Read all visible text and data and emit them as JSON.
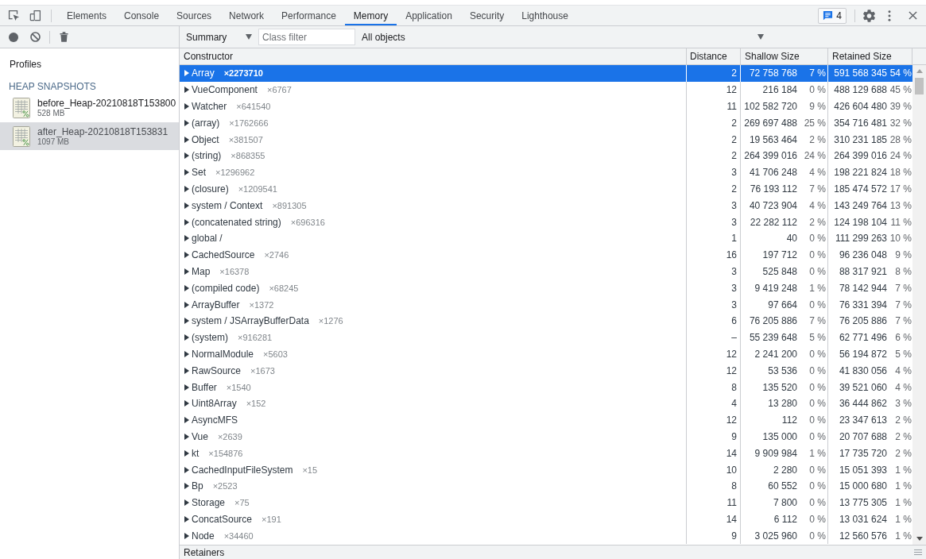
{
  "toolbar": {
    "tabs": [
      {
        "label": "Elements",
        "selected": false
      },
      {
        "label": "Console",
        "selected": false
      },
      {
        "label": "Sources",
        "selected": false
      },
      {
        "label": "Network",
        "selected": false
      },
      {
        "label": "Performance",
        "selected": false
      },
      {
        "label": "Memory",
        "selected": true
      },
      {
        "label": "Application",
        "selected": false
      },
      {
        "label": "Security",
        "selected": false
      },
      {
        "label": "Lighthouse",
        "selected": false
      }
    ],
    "issues_count": "4"
  },
  "memory_toolbar": {
    "view_select": "Summary",
    "class_filter": {
      "placeholder": "Class filter"
    },
    "object_select": "All objects"
  },
  "sidebar": {
    "title": "Profiles",
    "section": "HEAP SNAPSHOTS",
    "snapshots": [
      {
        "name": "before_Heap-20210818T153800",
        "size": "528 MB",
        "selected": false
      },
      {
        "name": "after_Heap-20210818T153831",
        "size": "1097 MB",
        "selected": true
      }
    ]
  },
  "table": {
    "columns": [
      "Constructor",
      "Distance",
      "Shallow Size",
      "Retained Size"
    ],
    "rows": [
      {
        "name": "Array",
        "count": "×2273710",
        "distance": "2",
        "shallow_size": "72 758 768",
        "shallow_percent": "7 %",
        "retained_size": "591 568 345",
        "retained_percent": "54 %",
        "selected": true,
        "expanded": false
      },
      {
        "name": "VueComponent",
        "count": "×6767",
        "distance": "12",
        "shallow_size": "216 184",
        "shallow_percent": "0 %",
        "retained_size": "488 129 688",
        "retained_percent": "45 %",
        "selected": false,
        "expanded": false
      },
      {
        "name": "Watcher",
        "count": "×641540",
        "distance": "11",
        "shallow_size": "102 582 720",
        "shallow_percent": "9 %",
        "retained_size": "426 604 480",
        "retained_percent": "39 %",
        "selected": false,
        "expanded": false
      },
      {
        "name": "(array)",
        "count": "×1762666",
        "distance": "2",
        "shallow_size": "269 697 488",
        "shallow_percent": "25 %",
        "retained_size": "354 716 481",
        "retained_percent": "32 %",
        "selected": false,
        "expanded": false
      },
      {
        "name": "Object",
        "count": "×381507",
        "distance": "2",
        "shallow_size": "19 563 464",
        "shallow_percent": "2 %",
        "retained_size": "310 231 185",
        "retained_percent": "28 %",
        "selected": false,
        "expanded": false
      },
      {
        "name": "(string)",
        "count": "×868355",
        "distance": "2",
        "shallow_size": "264 399 016",
        "shallow_percent": "24 %",
        "retained_size": "264 399 016",
        "retained_percent": "24 %",
        "selected": false,
        "expanded": false
      },
      {
        "name": "Set",
        "count": "×1296962",
        "distance": "3",
        "shallow_size": "41 706 248",
        "shallow_percent": "4 %",
        "retained_size": "198 221 824",
        "retained_percent": "18 %",
        "selected": false,
        "expanded": false
      },
      {
        "name": "(closure)",
        "count": "×1209541",
        "distance": "2",
        "shallow_size": "76 193 112",
        "shallow_percent": "7 %",
        "retained_size": "185 474 572",
        "retained_percent": "17 %",
        "selected": false,
        "expanded": false
      },
      {
        "name": "system / Context",
        "count": "×891305",
        "distance": "3",
        "shallow_size": "40 723 904",
        "shallow_percent": "4 %",
        "retained_size": "143 249 764",
        "retained_percent": "13 %",
        "selected": false,
        "expanded": false
      },
      {
        "name": "(concatenated string)",
        "count": "×696316",
        "distance": "3",
        "shallow_size": "22 282 112",
        "shallow_percent": "2 %",
        "retained_size": "124 198 104",
        "retained_percent": "11 %",
        "selected": false,
        "expanded": false
      },
      {
        "name": "global /",
        "distance": "1",
        "shallow_size": "40",
        "shallow_percent": "0 %",
        "retained_size": "111 299 263",
        "retained_percent": "10 %",
        "selected": false,
        "expanded": false
      },
      {
        "name": "CachedSource",
        "count": "×2746",
        "distance": "16",
        "shallow_size": "197 712",
        "shallow_percent": "0 %",
        "retained_size": "96 236 048",
        "retained_percent": "9 %",
        "selected": false,
        "expanded": false
      },
      {
        "name": "Map",
        "count": "×16378",
        "distance": "3",
        "shallow_size": "525 848",
        "shallow_percent": "0 %",
        "retained_size": "88 317 921",
        "retained_percent": "8 %",
        "selected": false,
        "expanded": false
      },
      {
        "name": "(compiled code)",
        "count": "×68245",
        "distance": "3",
        "shallow_size": "9 419 248",
        "shallow_percent": "1 %",
        "retained_size": "78 142 944",
        "retained_percent": "7 %",
        "selected": false,
        "expanded": false
      },
      {
        "name": "ArrayBuffer",
        "count": "×1372",
        "distance": "3",
        "shallow_size": "97 664",
        "shallow_percent": "0 %",
        "retained_size": "76 331 394",
        "retained_percent": "7 %",
        "selected": false,
        "expanded": false
      },
      {
        "name": "system / JSArrayBufferData",
        "count": "×1276",
        "distance": "6",
        "shallow_size": "76 205 886",
        "shallow_percent": "7 %",
        "retained_size": "76 205 886",
        "retained_percent": "7 %",
        "selected": false,
        "expanded": false
      },
      {
        "name": "(system)",
        "count": "×916281",
        "distance": "–",
        "shallow_size": "55 239 648",
        "shallow_percent": "5 %",
        "retained_size": "62 771 496",
        "retained_percent": "6 %",
        "selected": false,
        "expanded": false
      },
      {
        "name": "NormalModule",
        "count": "×5603",
        "distance": "12",
        "shallow_size": "2 241 200",
        "shallow_percent": "0 %",
        "retained_size": "56 194 872",
        "retained_percent": "5 %",
        "selected": false,
        "expanded": false
      },
      {
        "name": "RawSource",
        "count": "×1673",
        "distance": "12",
        "shallow_size": "53 536",
        "shallow_percent": "0 %",
        "retained_size": "41 830 056",
        "retained_percent": "4 %",
        "selected": false,
        "expanded": false
      },
      {
        "name": "Buffer",
        "count": "×1540",
        "distance": "8",
        "shallow_size": "135 520",
        "shallow_percent": "0 %",
        "retained_size": "39 521 060",
        "retained_percent": "4 %",
        "selected": false,
        "expanded": false
      },
      {
        "name": "Uint8Array",
        "count": "×152",
        "distance": "4",
        "shallow_size": "13 280",
        "shallow_percent": "0 %",
        "retained_size": "36 444 862",
        "retained_percent": "3 %",
        "selected": false,
        "expanded": false
      },
      {
        "name": "AsyncMFS",
        "distance": "12",
        "shallow_size": "112",
        "shallow_percent": "0 %",
        "retained_size": "23 347 613",
        "retained_percent": "2 %",
        "selected": false,
        "expanded": false
      },
      {
        "name": "Vue",
        "count": "×2639",
        "distance": "9",
        "shallow_size": "135 000",
        "shallow_percent": "0 %",
        "retained_size": "20 707 688",
        "retained_percent": "2 %",
        "selected": false,
        "expanded": false
      },
      {
        "name": "kt",
        "count": "×154876",
        "distance": "14",
        "shallow_size": "9 909 984",
        "shallow_percent": "1 %",
        "retained_size": "17 735 720",
        "retained_percent": "2 %",
        "selected": false,
        "expanded": false
      },
      {
        "name": "CachedInputFileSystem",
        "count": "×15",
        "distance": "10",
        "shallow_size": "2 280",
        "shallow_percent": "0 %",
        "retained_size": "15 051 393",
        "retained_percent": "1 %",
        "selected": false,
        "expanded": false
      },
      {
        "name": "Bp",
        "count": "×2523",
        "distance": "8",
        "shallow_size": "60 552",
        "shallow_percent": "0 %",
        "retained_size": "15 000 680",
        "retained_percent": "1 %",
        "selected": false,
        "expanded": false
      },
      {
        "name": "Storage",
        "count": "×75",
        "distance": "11",
        "shallow_size": "7 800",
        "shallow_percent": "0 %",
        "retained_size": "13 775 305",
        "retained_percent": "1 %",
        "selected": false,
        "expanded": false
      },
      {
        "name": "ConcatSource",
        "count": "×191",
        "distance": "14",
        "shallow_size": "6 112",
        "shallow_percent": "0 %",
        "retained_size": "13 031 624",
        "retained_percent": "1 %",
        "selected": false,
        "expanded": false
      },
      {
        "name": "Node",
        "count": "×34460",
        "distance": "9",
        "shallow_size": "3 025 960",
        "shallow_percent": "0 %",
        "retained_size": "12 560 576",
        "retained_percent": "1 %",
        "selected": false,
        "expanded": false
      }
    ]
  },
  "retainers_panel": {
    "title": "Retainers"
  }
}
